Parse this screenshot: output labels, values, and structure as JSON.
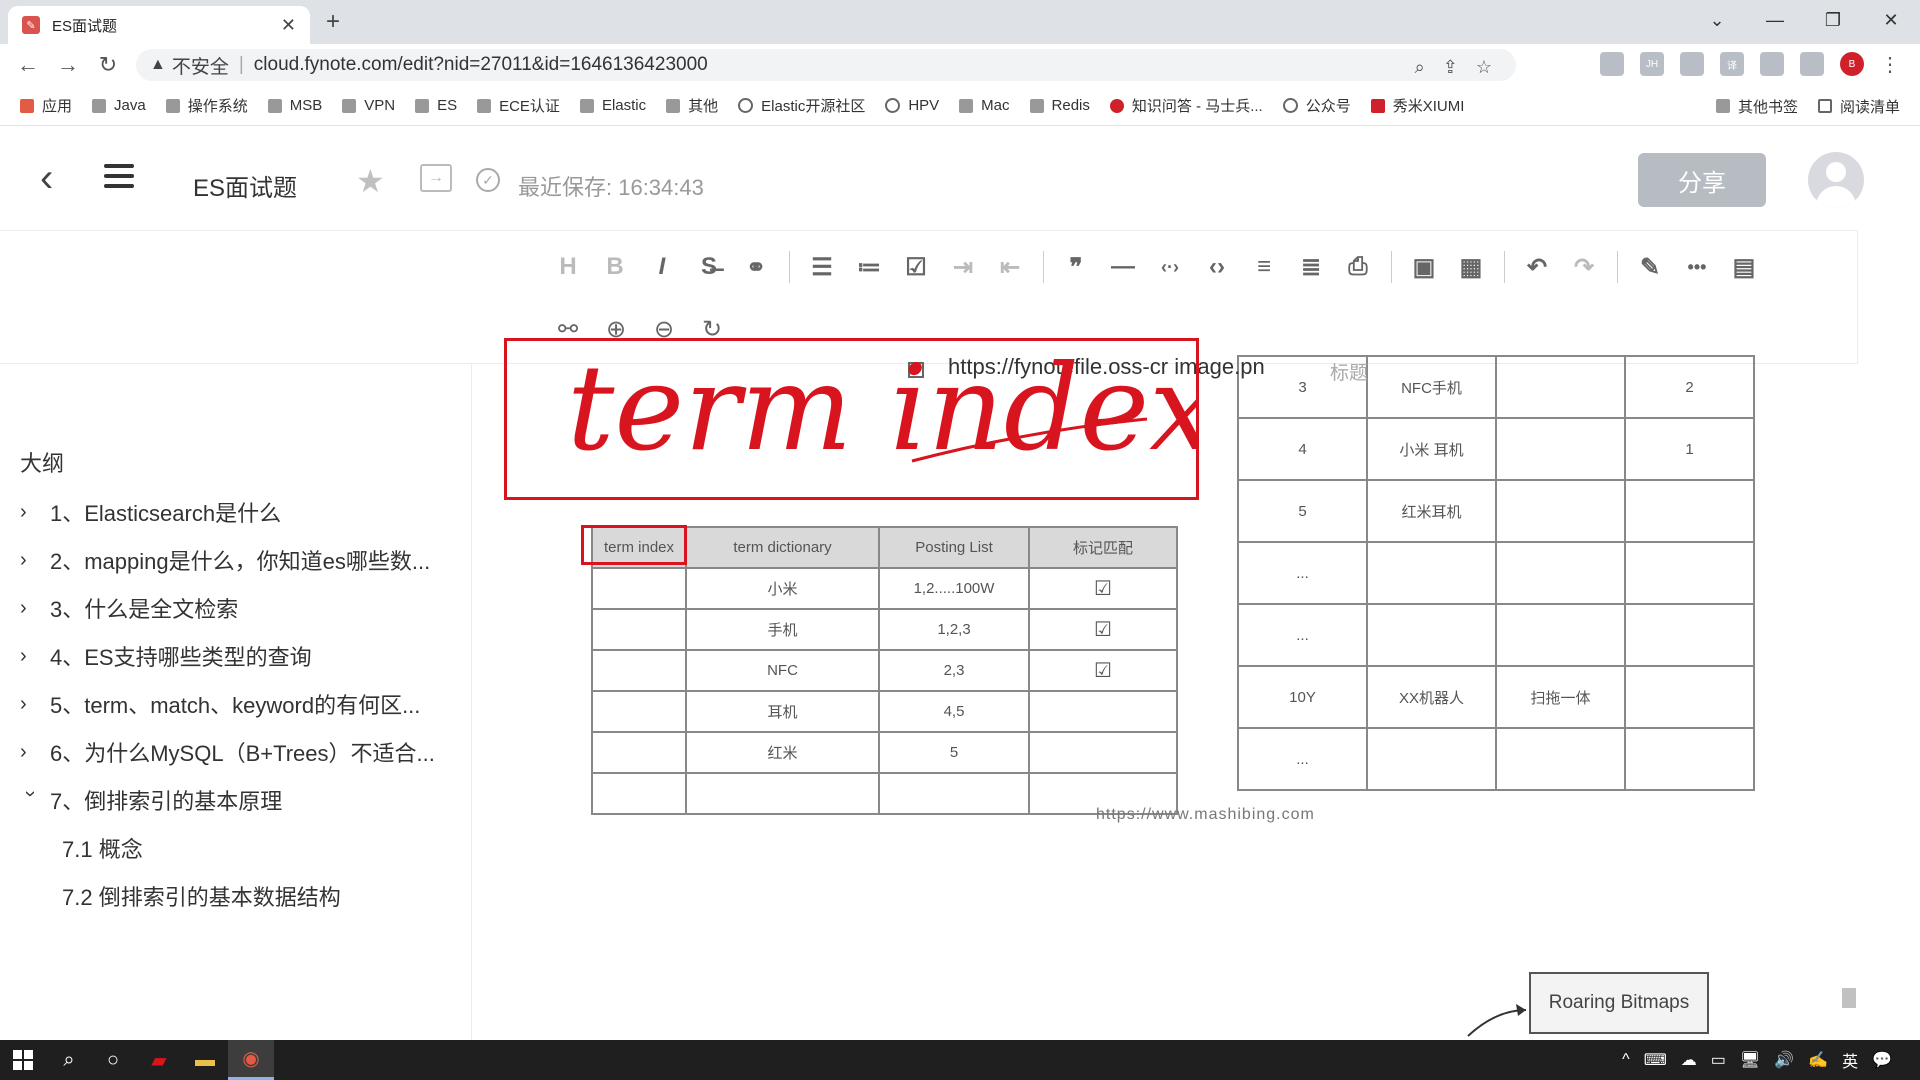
{
  "browser": {
    "tab_title": "ES面试题",
    "tab_close": "✕",
    "new_tab": "+",
    "window_controls": [
      "⌄",
      "—",
      "❐",
      "✕"
    ],
    "nav": {
      "back": "←",
      "forward": "→",
      "reload": "↻"
    },
    "address": {
      "warning_glyph": "▲",
      "insecure_label": "不安全",
      "separator": "|",
      "url": "cloud.fynote.com/edit?nid=27011&id=1646136423000"
    },
    "ext_labels": [
      "JH",
      "译",
      "B"
    ],
    "bookmarks": [
      {
        "label": "应用",
        "icon": "apps-grid-icon"
      },
      {
        "label": "Java",
        "icon": "folder-icon"
      },
      {
        "label": "操作系统",
        "icon": "folder-icon"
      },
      {
        "label": "MSB",
        "icon": "folder-icon"
      },
      {
        "label": "VPN",
        "icon": "folder-icon"
      },
      {
        "label": "ES",
        "icon": "folder-icon"
      },
      {
        "label": "ECE认证",
        "icon": "folder-icon"
      },
      {
        "label": "Elastic",
        "icon": "folder-icon"
      },
      {
        "label": "其他",
        "icon": "folder-icon"
      },
      {
        "label": "Elastic开源社区",
        "icon": "globe-icon"
      },
      {
        "label": "HPV",
        "icon": "globe-icon"
      },
      {
        "label": "Mac",
        "icon": "folder-icon"
      },
      {
        "label": "Redis",
        "icon": "folder-icon"
      },
      {
        "label": "知识问答 - 马士兵...",
        "icon": "site-icon"
      },
      {
        "label": "公众号",
        "icon": "site-icon"
      },
      {
        "label": "秀米XIUMI",
        "icon": "site-icon"
      }
    ],
    "bookmarks_right": [
      "其他书签",
      "阅读清单"
    ]
  },
  "app": {
    "doc_title": "ES面试题",
    "save_status": "最近保存: 16:34:43",
    "share_label": "分享",
    "back_glyph": "‹"
  },
  "toolbar": {
    "row1": [
      "H",
      "B",
      "I",
      "S̶",
      "🔗",
      "|",
      "☰",
      "≔",
      "☑",
      "⇥",
      "⇤",
      "|",
      "❞",
      "—",
      "‹·›",
      "‹›",
      "≡",
      "≣",
      "⎙",
      "|",
      "🖼",
      "▦",
      "|",
      "↶",
      "↷",
      "|",
      "✎",
      "•••",
      "▤"
    ],
    "row2": [
      "⚯",
      "⊕",
      "⊖",
      "↻"
    ]
  },
  "outline": {
    "title": "大纲",
    "items": [
      {
        "label": "1、Elasticsearch是什么",
        "expanded": false
      },
      {
        "label": "2、mapping是什么，你知道es哪些数...",
        "expanded": false
      },
      {
        "label": "3、什么是全文检索",
        "expanded": false
      },
      {
        "label": "4、ES支持哪些类型的查询",
        "expanded": false
      },
      {
        "label": "5、term、match、keyword的有何区...",
        "expanded": false
      },
      {
        "label": "6、为什么MySQL（B+Trees）不适合...",
        "expanded": false
      },
      {
        "label": "7、倒排索引的基本原理",
        "expanded": true
      }
    ],
    "subitems": [
      "7.1 概念",
      "7.2 倒排索引的基本数据结构"
    ]
  },
  "canvas": {
    "handwriting": "term index",
    "image_caption": "https://fynotefile.oss-cr   image.pn",
    "caption_label": "标题",
    "table1": {
      "headers": [
        "term index",
        "term dictionary",
        "Posting List",
        "标记匹配"
      ],
      "rows": [
        [
          "",
          "小米",
          "1,2.....100W",
          "☑"
        ],
        [
          "",
          "手机",
          "1,2,3",
          "☑"
        ],
        [
          "",
          "NFC",
          "2,3",
          "☑"
        ],
        [
          "",
          "耳机",
          "4,5",
          ""
        ],
        [
          "",
          "红米",
          "5",
          ""
        ],
        [
          "",
          "",
          "",
          ""
        ]
      ]
    },
    "table2": {
      "rows": [
        [
          "3",
          "NFC手机",
          "",
          "2"
        ],
        [
          "4",
          "小米 耳机",
          "",
          "1"
        ],
        [
          "5",
          "红米耳机",
          "",
          ""
        ],
        [
          "...",
          "",
          "",
          ""
        ],
        [
          "...",
          "",
          "",
          ""
        ],
        [
          "10Y",
          "XX机器人",
          "扫拖一体",
          ""
        ],
        [
          "...",
          "",
          "",
          ""
        ]
      ]
    },
    "underlay_url": "https://www.mashibing.com",
    "roaring_label": "Roaring Bitmaps"
  },
  "taskbar": {
    "tray": [
      "^",
      "⌨",
      "☁",
      "▭",
      "🖥",
      "🔊",
      "✍",
      "英",
      "💬"
    ]
  },
  "colors": {
    "accent_red": "#d8141f",
    "share_button": "#b7bcc2",
    "tabbar": "#dee1e6"
  }
}
